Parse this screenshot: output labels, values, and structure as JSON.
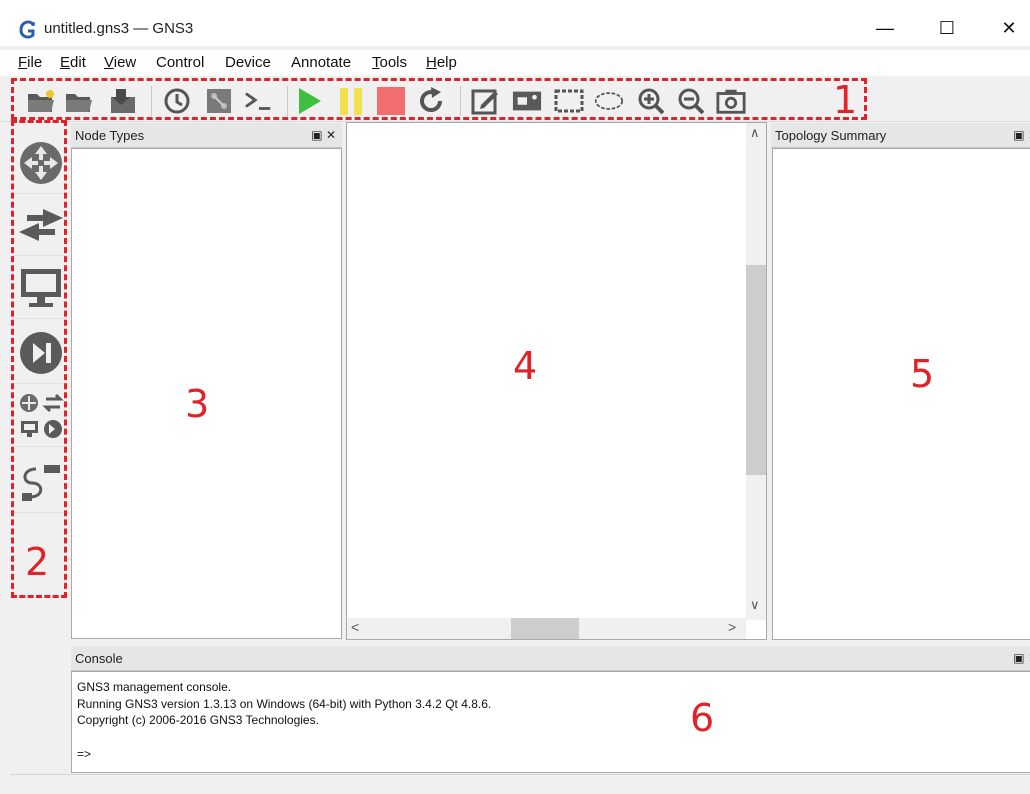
{
  "window": {
    "title": "untitled.gns3 — GNS3",
    "minimize_glyph": "—",
    "maximize_glyph": "☐",
    "close_glyph": "✕"
  },
  "menu": [
    {
      "first": "F",
      "rest": "ile"
    },
    {
      "first": "E",
      "rest": "dit"
    },
    {
      "first": "V",
      "rest": "iew"
    },
    {
      "first": "",
      "rest": "Control"
    },
    {
      "first": "",
      "rest": "Device"
    },
    {
      "first": "",
      "rest": "Annotate"
    },
    {
      "first": "T",
      "rest": "ools"
    },
    {
      "first": "H",
      "rest": "elp"
    }
  ],
  "toolbar_icons": [
    "new-project-icon",
    "open-project-icon",
    "save-project-icon",
    "snapshot-icon",
    "show-interface-labels-icon",
    "console-icon",
    "start-icon",
    "suspend-icon",
    "stop-icon",
    "reload-icon",
    "add-note-icon",
    "insert-picture-icon",
    "draw-rectangle-icon",
    "draw-ellipse-icon",
    "zoom-in-icon",
    "zoom-out-icon",
    "screenshot-icon"
  ],
  "device_icons": [
    "routers-icon",
    "switches-icon",
    "end-devices-icon",
    "security-devices-icon",
    "all-devices-icon",
    "add-link-icon"
  ],
  "annotations": {
    "n1": "1",
    "n2": "2",
    "n3": "3",
    "n4": "4",
    "n5": "5",
    "n6": "6"
  },
  "node_types": {
    "title": "Node Types",
    "controls": "▣ ✕"
  },
  "topology_summary": {
    "title": "Topology Summary",
    "controls": "▣ ✕"
  },
  "console": {
    "title": "Console",
    "controls": "▣ ✕",
    "lines": [
      "GNS3 management console.",
      "Running GNS3 version 1.3.13 on Windows (64-bit) with Python 3.4.2 Qt 4.8.6.",
      "Copyright (c) 2006-2016 GNS3 Technologies.",
      "",
      "=>"
    ]
  },
  "scrollbars": {
    "up": "∧",
    "down": "∨",
    "left": "<",
    "right": ">"
  },
  "colors": {
    "annotation": "#e0232a",
    "start": "#3fbf3f",
    "suspend": "#f4e04d",
    "stop": "#f26e6e"
  }
}
